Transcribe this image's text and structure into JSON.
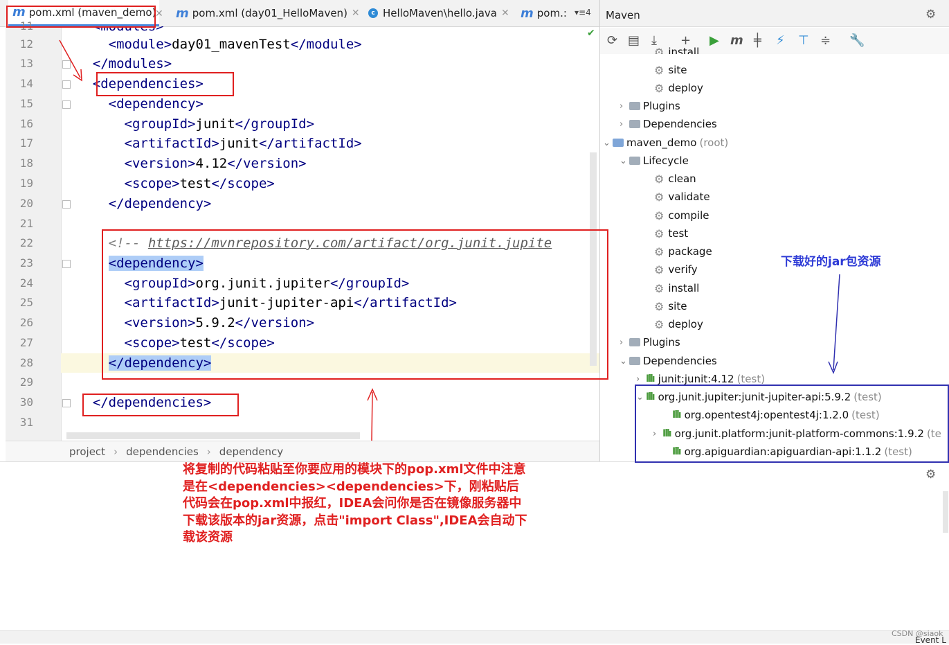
{
  "tabs": [
    {
      "label": "pom.xml (maven_demo)",
      "icon": "m"
    },
    {
      "label": "pom.xml (day01_HelloMaven)",
      "icon": "m"
    },
    {
      "label": "HelloMaven\\hello.java",
      "icon": "c"
    },
    {
      "label": "pom.:",
      "icon": "m"
    }
  ],
  "tab_overflow": "▾≡4",
  "line_numbers": [
    "11",
    "12",
    "13",
    "14",
    "15",
    "16",
    "17",
    "18",
    "19",
    "20",
    "21",
    "22",
    "23",
    "24",
    "25",
    "26",
    "27",
    "28",
    "29",
    "30",
    "31"
  ],
  "code": {
    "l11_tag": "<modules>",
    "l12_open": "<module>",
    "l12_text": "day01_mavenTest",
    "l12_close": "</module>",
    "l13": "</modules>",
    "l14": "<dependencies>",
    "l15": "<dependency>",
    "l16_open": "<groupId>",
    "l16_text": "junit",
    "l16_close": "</groupId>",
    "l17_open": "<artifactId>",
    "l17_text": "junit",
    "l17_close": "</artifactId>",
    "l18_open": "<version>",
    "l18_text": "4.12",
    "l18_close": "</version>",
    "l19_open": "<scope>",
    "l19_text": "test",
    "l19_close": "</scope>",
    "l20": "</dependency>",
    "l22_prefix": "<!-- ",
    "l22_url": "https://mvnrepository.com/artifact/org.junit.jupite",
    "l23": "<dependency>",
    "l24_open": "<groupId>",
    "l24_text": "org.junit.jupiter",
    "l24_close": "</groupId>",
    "l25_open": "<artifactId>",
    "l25_text": "junit-jupiter-api",
    "l25_close": "</artifactId>",
    "l26_open": "<version>",
    "l26_text": "5.9.2",
    "l26_close": "</version>",
    "l27_open": "<scope>",
    "l27_text": "test",
    "l27_close": "</scope>",
    "l28": "</dependency>",
    "l30": "</dependencies>"
  },
  "breadcrumb": [
    "project",
    "dependencies",
    "dependency"
  ],
  "maven": {
    "title": "Maven",
    "tree_top": [
      {
        "label": "install"
      },
      {
        "label": "site"
      },
      {
        "label": "deploy"
      }
    ],
    "plugins_label": "Plugins",
    "dependencies_label": "Dependencies",
    "root_label": "maven_demo",
    "root_suffix": "(root)",
    "lifecycle_label": "Lifecycle",
    "lifecycle": [
      "clean",
      "validate",
      "compile",
      "test",
      "package",
      "verify",
      "install",
      "site",
      "deploy"
    ],
    "deps": [
      {
        "label": "junit:junit:4.12",
        "scope": "(test)"
      },
      {
        "label": "org.junit.jupiter:junit-jupiter-api:5.9.2",
        "scope": "(test)"
      },
      {
        "label": "org.opentest4j:opentest4j:1.2.0",
        "scope": "(test)"
      },
      {
        "label": "org.junit.platform:junit-platform-commons:1.9.2",
        "scope": "(te"
      },
      {
        "label": "org.apiguardian:apiguardian-api:1.1.2",
        "scope": "(test)"
      }
    ]
  },
  "annotation_red": "将复制的代码粘贴至你要应用的模块下的pop.xml文件中注意是在<dependencies><dependencies>下，刚粘贴后代码会在pop.xml中报红，IDEA会问你是否在镜像服务器中下载该版本的jar资源，点击\"import Class\",IDEA会自动下载该资源",
  "annotation_blue": "下载好的jar包资源",
  "status_watermark": "CSDN @siaok",
  "status_event": "Event L",
  "colors": {
    "red": "#e02020",
    "blue": "#3030b0",
    "tag": "#000080",
    "highlight": "#aecdf7"
  }
}
